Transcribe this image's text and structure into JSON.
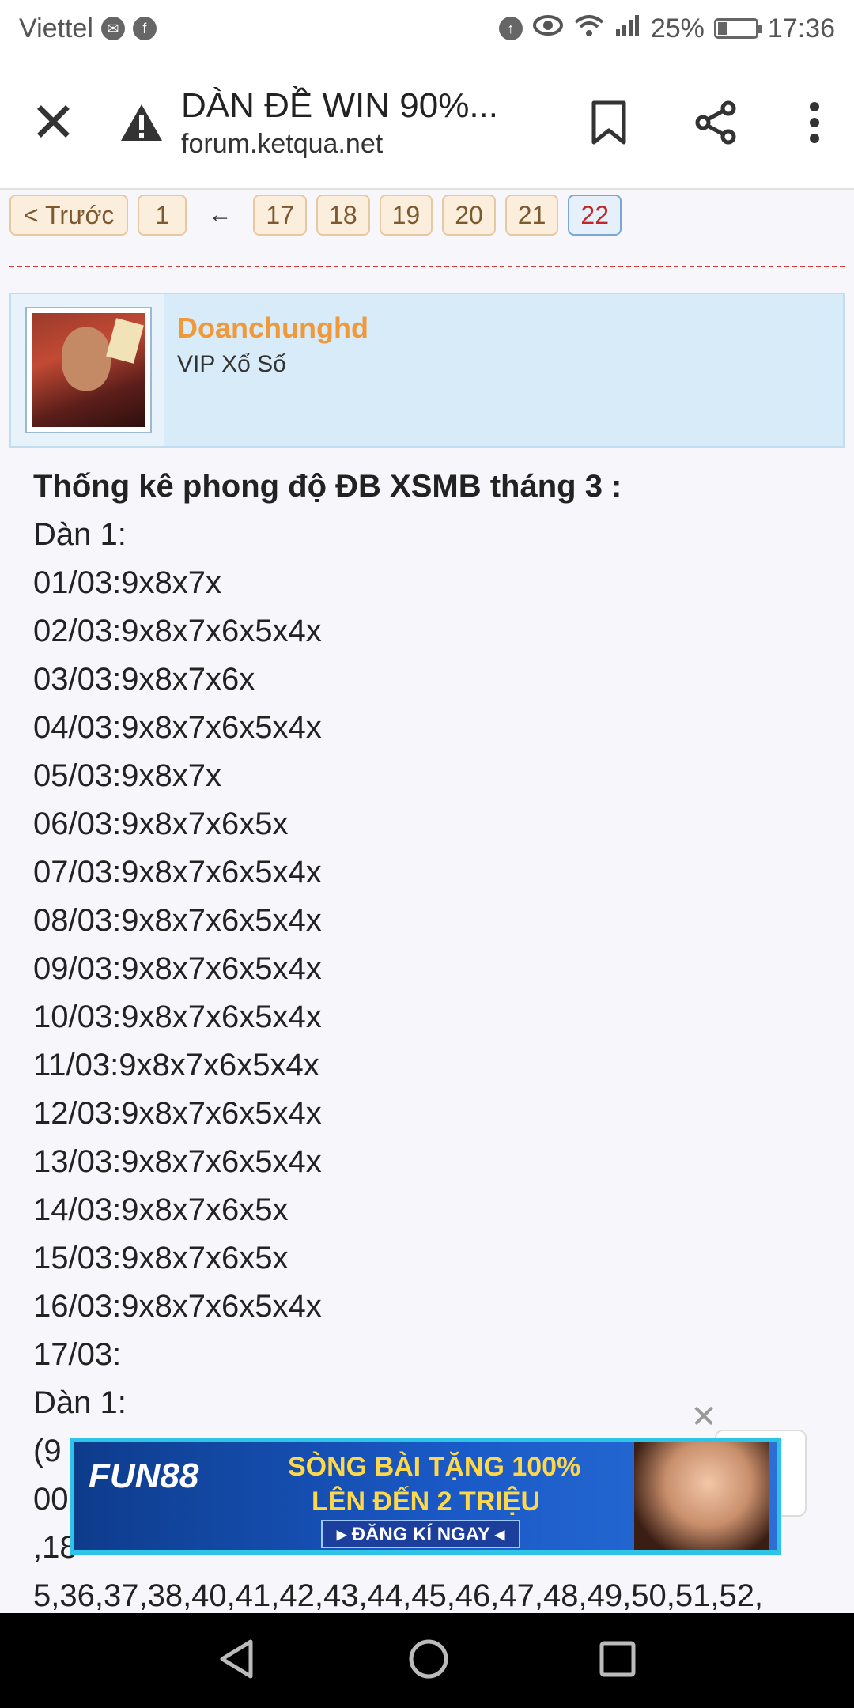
{
  "status_bar": {
    "carrier": "Viettel",
    "battery": "25%",
    "time": "17:36",
    "icons": [
      "messenger-icon",
      "facebook-icon",
      "data-saver-icon",
      "eye-icon",
      "wifi-icon",
      "signal-icon",
      "battery-icon"
    ]
  },
  "toolbar": {
    "title": "DÀN ĐỀ WIN 90%...",
    "url": "forum.ketqua.net"
  },
  "pager": {
    "prev_label": "< Trước",
    "first": "1",
    "ellipsis": "←",
    "pages": [
      "17",
      "18",
      "19",
      "20",
      "21"
    ],
    "current": "22"
  },
  "post_author": {
    "name": "Doanchunghd",
    "role": "VIP Xổ Số"
  },
  "post": {
    "heading": "Thống kê phong độ ĐB XSMB tháng 3 :",
    "lines": [
      "Dàn 1:",
      "01/03:9x8x7x",
      "02/03:9x8x7x6x5x4x",
      "03/03:9x8x7x6x",
      "04/03:9x8x7x6x5x4x",
      "05/03:9x8x7x",
      "06/03:9x8x7x6x5x",
      "07/03:9x8x7x6x5x4x",
      "08/03:9x8x7x6x5x4x",
      "09/03:9x8x7x6x5x4x",
      "10/03:9x8x7x6x5x4x",
      "11/03:9x8x7x6x5x4x",
      "12/03:9x8x7x6x5x4x",
      "13/03:9x8x7x6x5x4x",
      "14/03:9x8x7x6x5x",
      "15/03:9x8x7x6x5x",
      "16/03:9x8x7x6x5x4x",
      "17/03:",
      "Dàn 1:",
      "(9",
      "00",
      ",18",
      "5,36,37,38,40,41,42,43,44,45,46,47,48,49,50,51,52,"
    ]
  },
  "ad": {
    "brand": "FUN88",
    "line1": "SÒNG BÀI TẶNG 100%",
    "line2": "LÊN ĐẾN 2 TRIỆU",
    "cta": "▸ ĐĂNG KÍ NGAY ◂",
    "close": "✕"
  },
  "colors": {
    "username": "#f0993a",
    "current_page": "#c0262a",
    "divider": "#d43a3a",
    "userbox_bg": "#d7ebf8"
  }
}
